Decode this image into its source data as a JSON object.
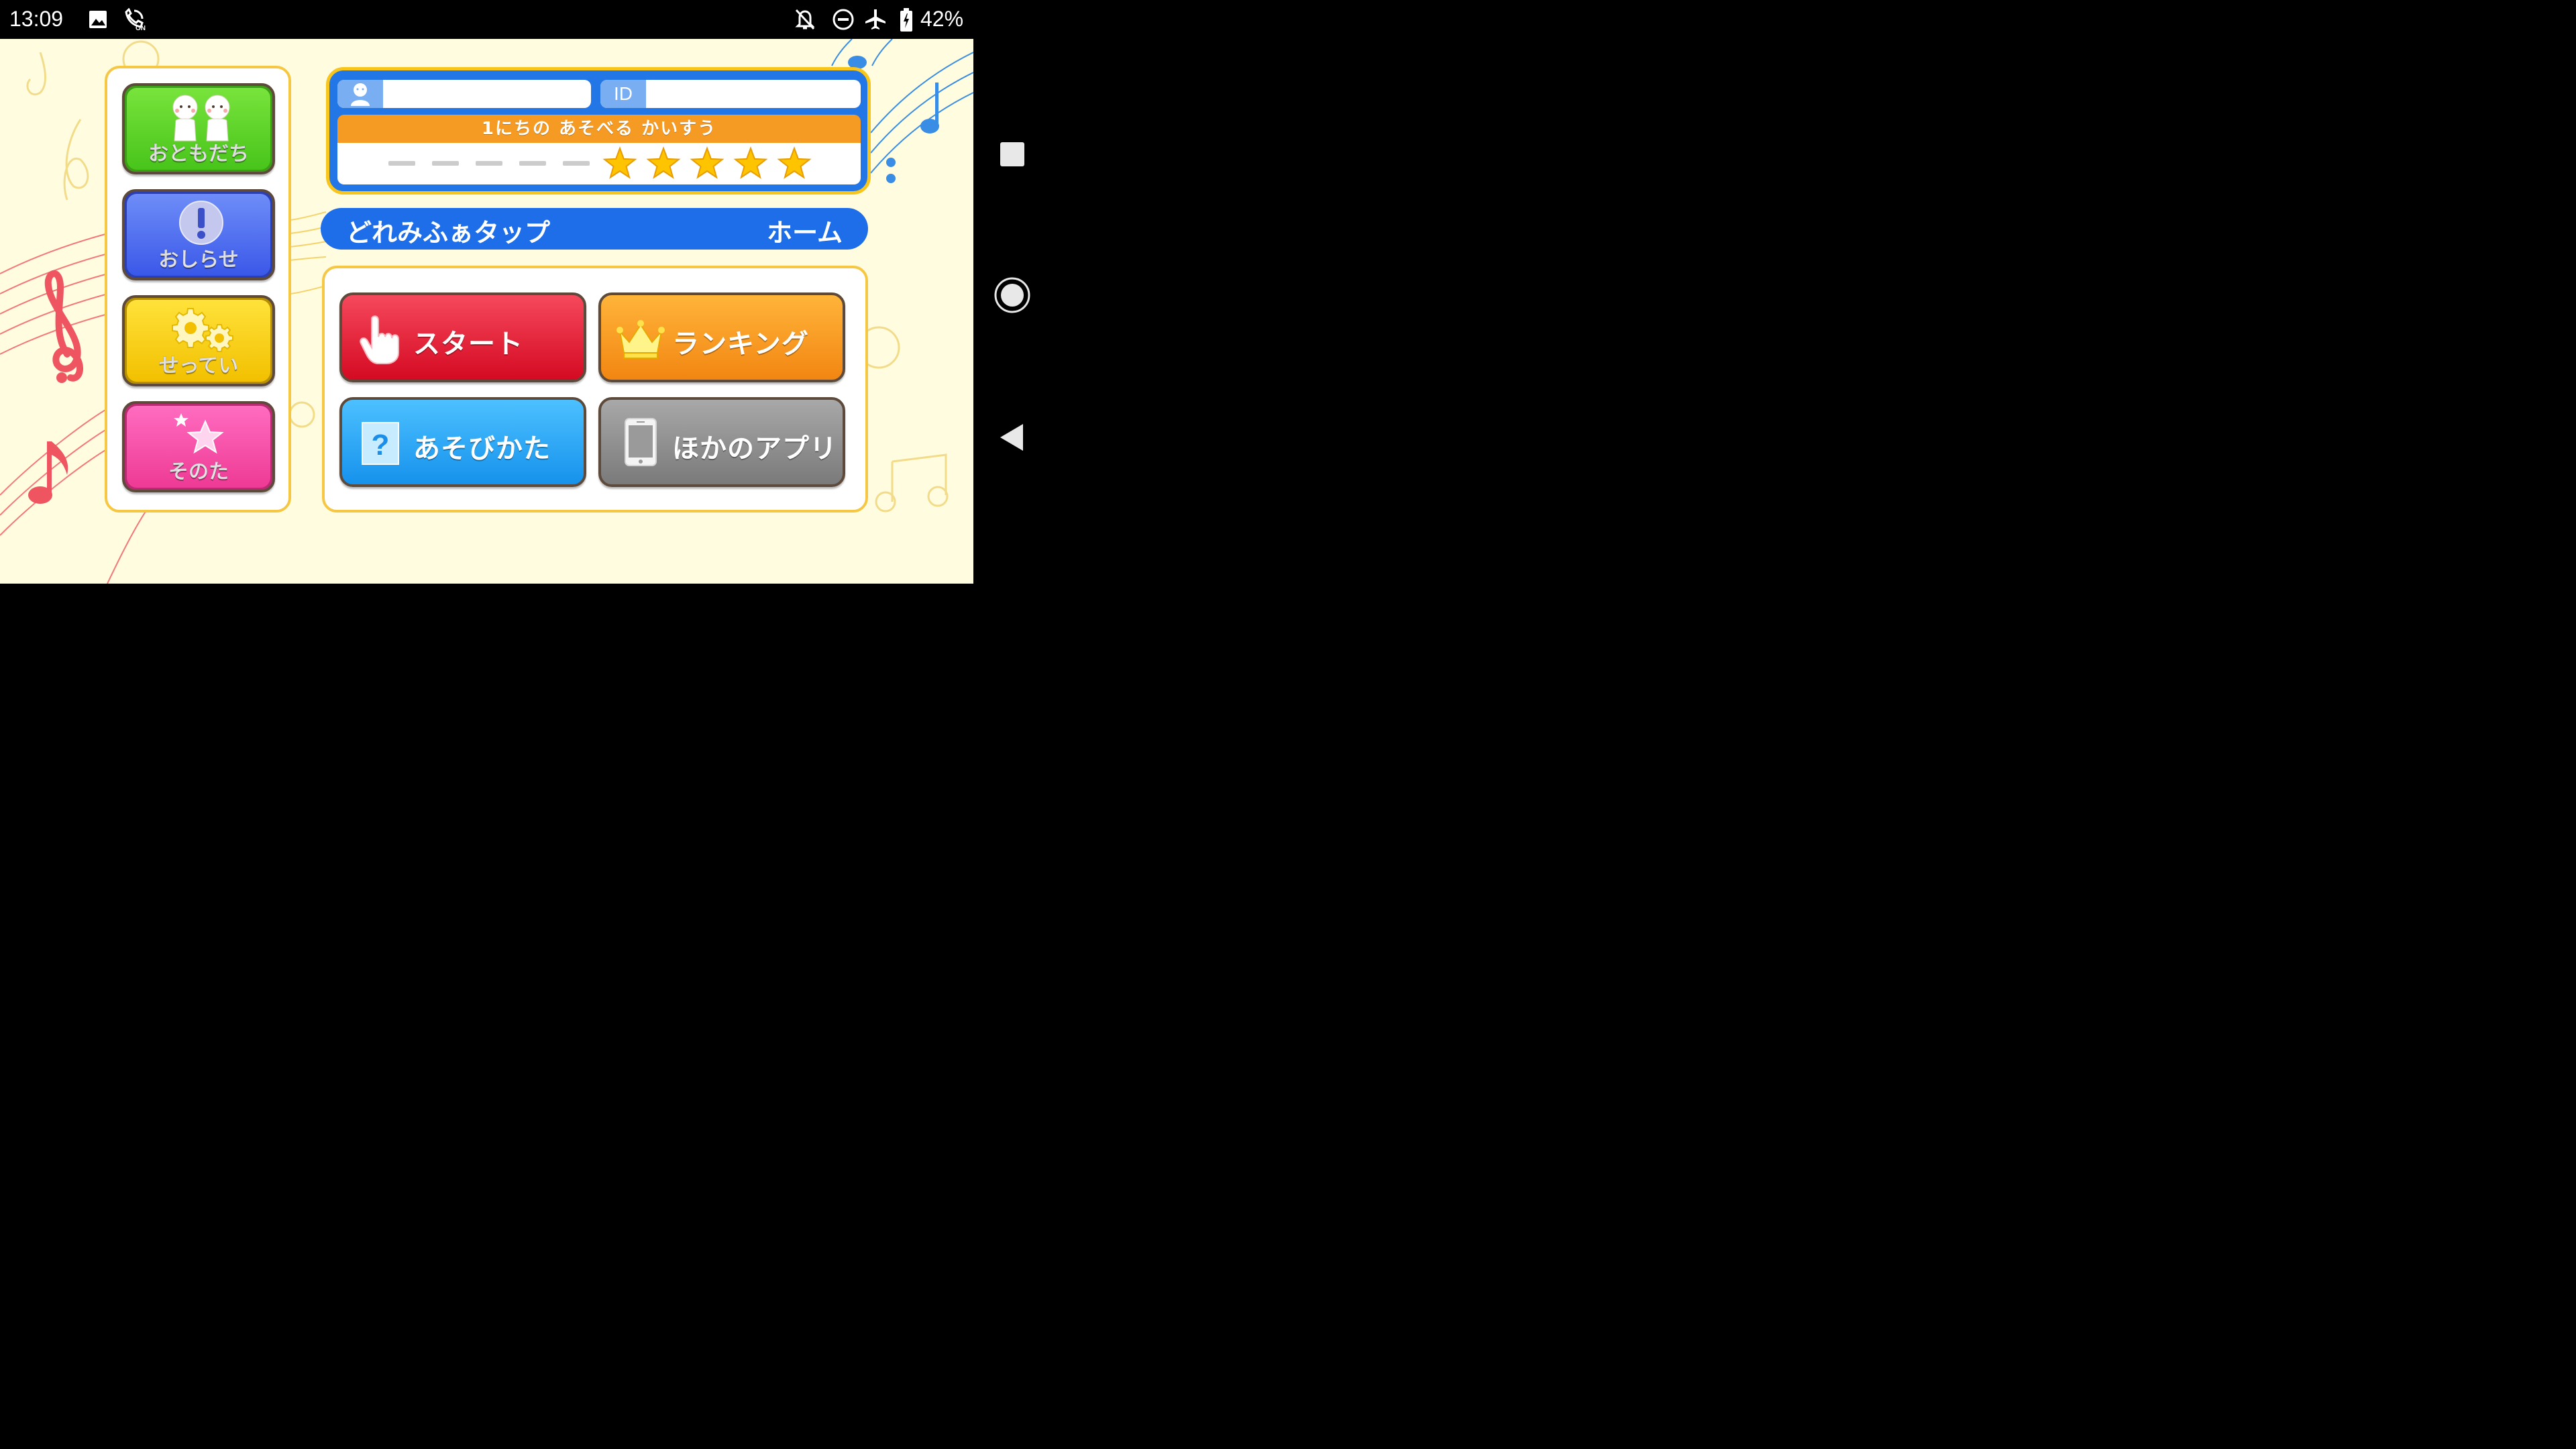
{
  "status_bar": {
    "time": "13:09",
    "battery": "42%",
    "icons": [
      "image-icon",
      "wifi-calling-icon",
      "notifications-off-icon",
      "do-not-disturb-icon",
      "airplane-icon",
      "battery-icon"
    ]
  },
  "sidebar": {
    "friends": "おともだち",
    "news": "おしらせ",
    "settings": "せってい",
    "other": "そのた"
  },
  "profile": {
    "user_name": "",
    "id_label": "ID",
    "id_value": "",
    "plays_header": "1にちの あそべる かいすう",
    "plays_used": 5,
    "plays_remaining": 5
  },
  "title_bar": {
    "app_name": "どれみふぁタップ",
    "page_name": "ホーム"
  },
  "main_menu": {
    "start": "スタート",
    "ranking": "ランキング",
    "how_to_play": "あそびかた",
    "other_apps": "ほかのアプリ"
  },
  "colors": {
    "background": "#fffce0",
    "panel_border": "#f6c743",
    "friends": "#4cc91c",
    "news": "#4f6ef0",
    "settings": "#f5c400",
    "other": "#f0489c",
    "start": "#e01a32",
    "ranking": "#f5901d",
    "how_to_play": "#1a9ef0",
    "other_apps": "#8a8a8a",
    "title_bar": "#1d6ee8"
  }
}
